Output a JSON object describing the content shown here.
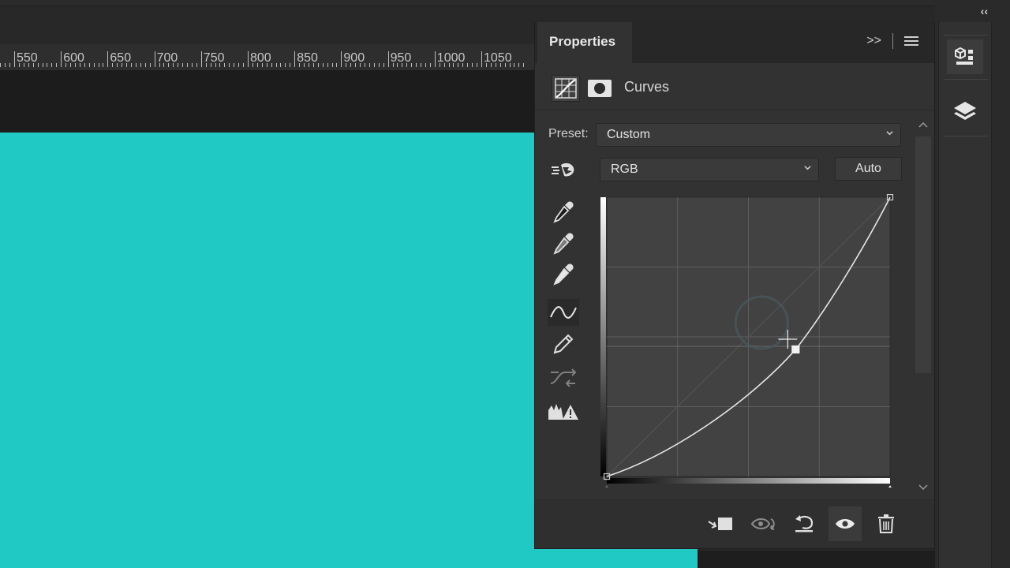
{
  "ruler": {
    "labels": [
      "550",
      "600",
      "650",
      "700",
      "750",
      "800",
      "850",
      "900",
      "950",
      "1000",
      "1050"
    ]
  },
  "colors": {
    "canvas": "#21c9c4",
    "panel": "#323232",
    "accent_text": "#e8e8e8"
  },
  "dock": {
    "collapse_label": "‹‹",
    "items": [
      {
        "icon": "libraries-icon",
        "active": true
      },
      {
        "icon": "layers-icon",
        "active": false
      }
    ]
  },
  "panel": {
    "tab_title": "Properties",
    "tab_menu": {
      "expand_label": ">>",
      "menu_icon": "hamburger-menu-icon"
    },
    "adjustment_title": "Curves",
    "preset": {
      "label": "Preset:",
      "value": "Custom"
    },
    "channel": {
      "value": "RGB"
    },
    "auto_label": "Auto",
    "tools": [
      {
        "icon": "on-image-adjust-icon"
      },
      {
        "icon": "black-point-eyedropper-icon"
      },
      {
        "icon": "gray-point-eyedropper-icon"
      },
      {
        "icon": "white-point-eyedropper-icon"
      },
      {
        "icon": "curve-points-icon",
        "selected": true
      },
      {
        "icon": "pencil-draw-icon"
      },
      {
        "icon": "smooth-curve-icon",
        "disabled": true
      },
      {
        "icon": "clipping-warning-icon"
      }
    ],
    "curve": {
      "points": [
        {
          "input": 0,
          "output": 0
        },
        {
          "input": 170,
          "output": 116
        },
        {
          "input": 255,
          "output": 255
        }
      ],
      "grid_divisions": 4
    },
    "footer_buttons": [
      {
        "icon": "clip-to-layer-icon"
      },
      {
        "icon": "view-previous-state-icon",
        "disabled": true
      },
      {
        "icon": "reset-defaults-icon"
      },
      {
        "icon": "toggle-visibility-icon",
        "highlighted": true
      },
      {
        "icon": "delete-layer-icon"
      }
    ]
  }
}
